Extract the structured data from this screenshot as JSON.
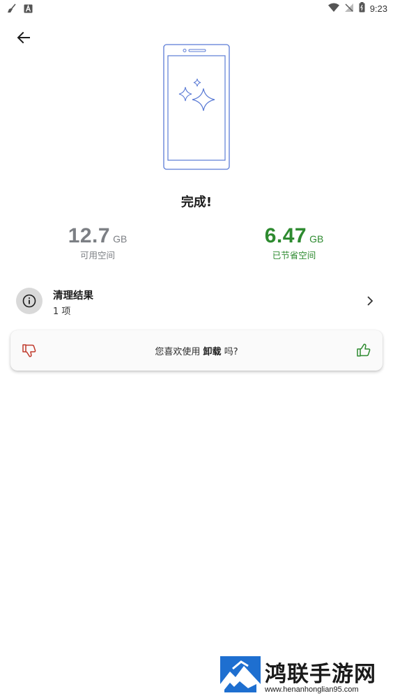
{
  "status_bar": {
    "time": "9:23",
    "left_icons": [
      "broom-icon",
      "a-letter-icon"
    ],
    "right_icons": [
      "wifi-icon",
      "no-signal-icon",
      "battery-icon"
    ]
  },
  "header": {
    "back_icon": "back-arrow-icon"
  },
  "illustration": {
    "icon": "phone-sparkle-illustration",
    "color": "#5b7bd5"
  },
  "completion": {
    "title": "完成!",
    "free_space": {
      "value": "12.7",
      "unit": "GB",
      "label": "可用空间",
      "color": "#7c7f84"
    },
    "saved_space": {
      "value": "6.47",
      "unit": "GB",
      "label": "已节省空间",
      "color": "#2d8a2f"
    }
  },
  "result": {
    "title": "清理结果",
    "subtitle": "1 项",
    "icon": "info-icon"
  },
  "feedback": {
    "prefix": "您喜欢使用",
    "app_name": "卸载",
    "suffix": "吗?",
    "thumb_down_color": "#c0392b",
    "thumb_up_color": "#2d8a2f"
  },
  "watermark": {
    "title": "鸿联手游网",
    "url": "www.henanhonglian95.com"
  }
}
